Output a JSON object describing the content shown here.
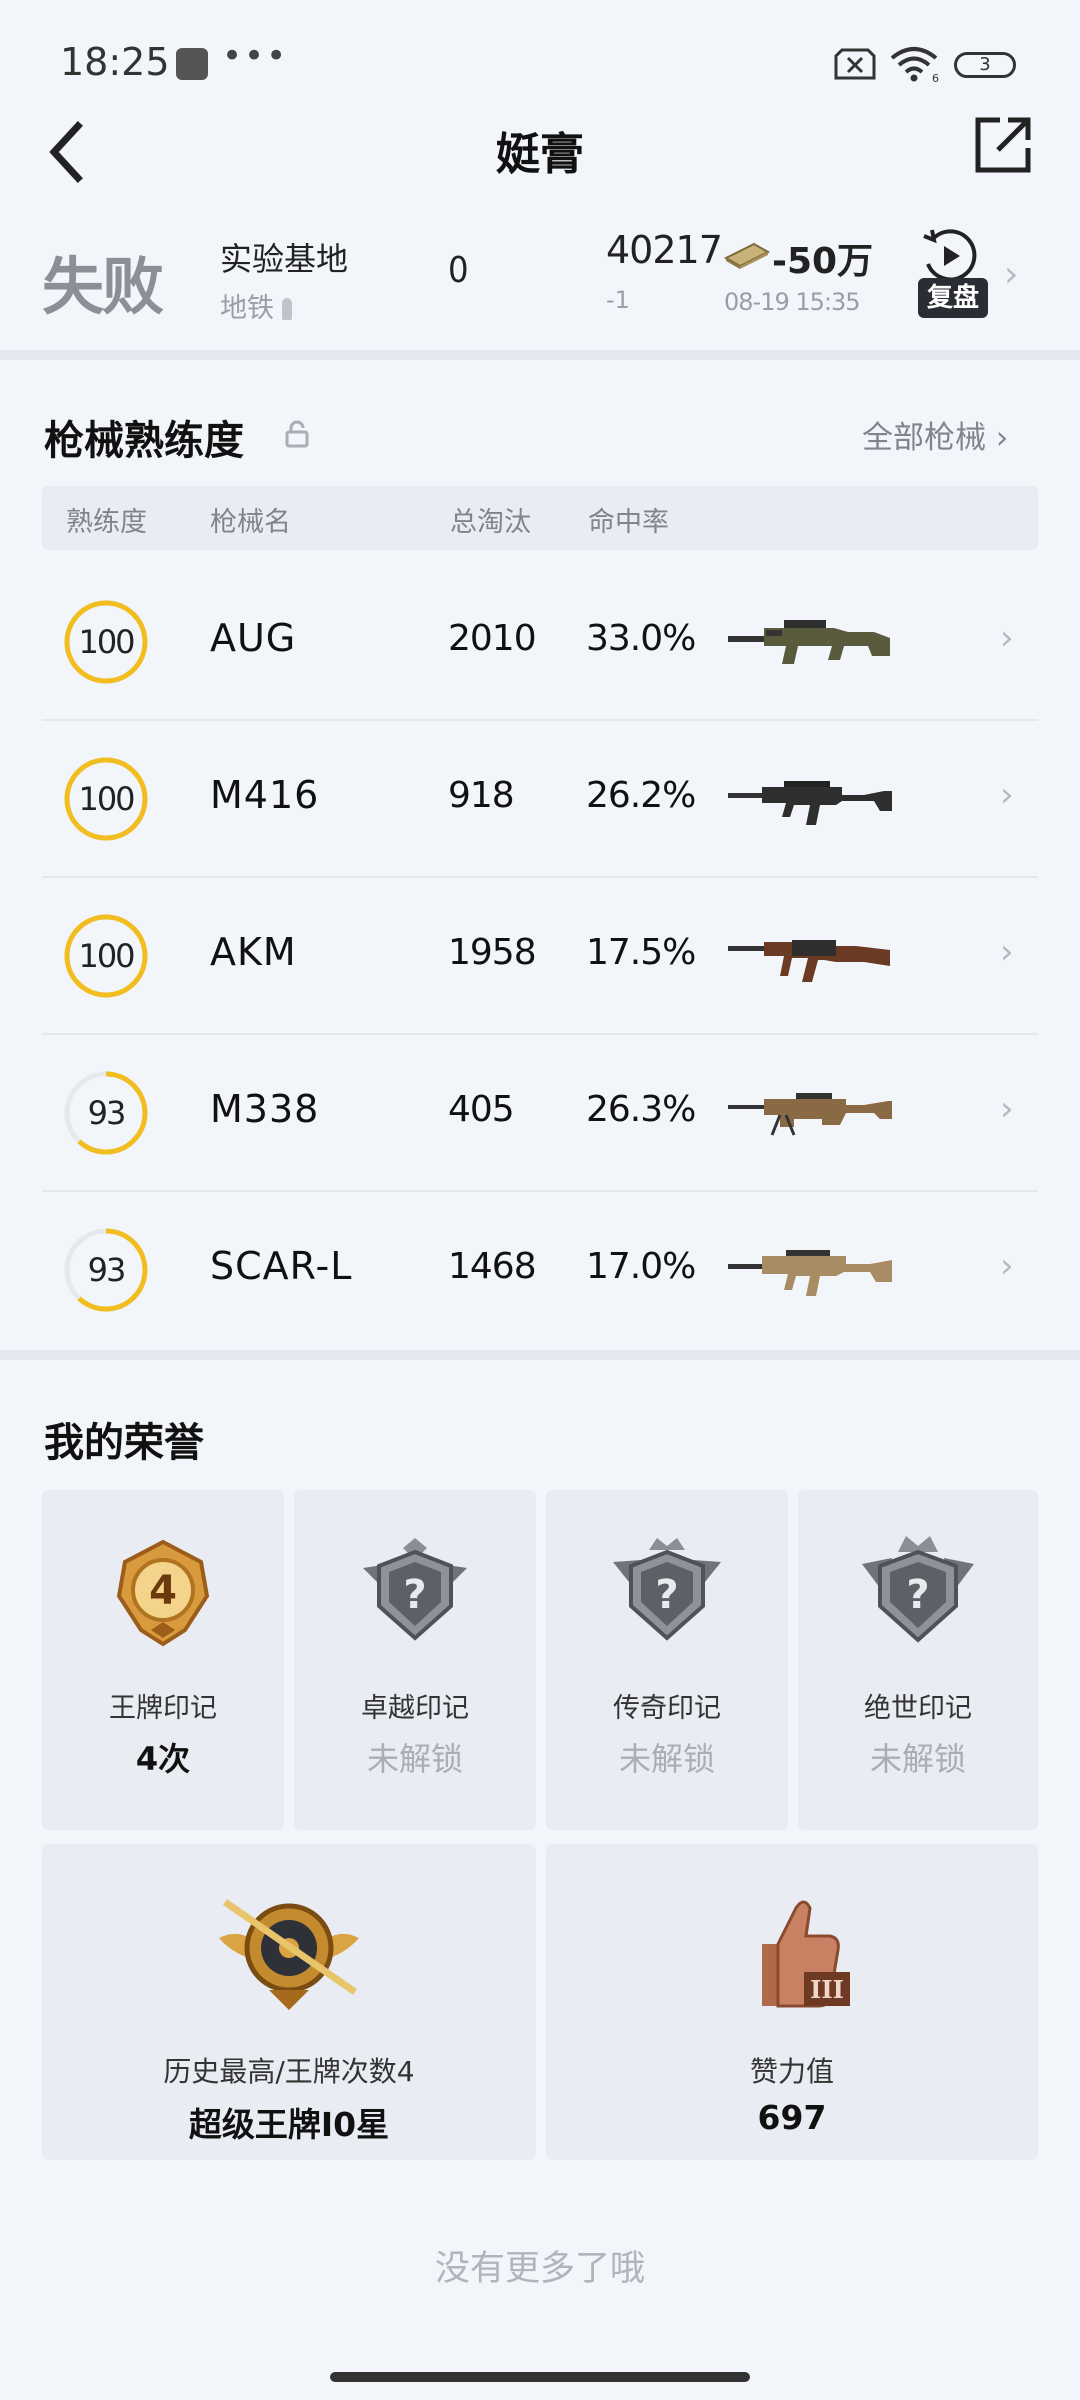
{
  "status_bar": {
    "time": "18:25",
    "dots": "•••",
    "battery": "3",
    "wifi_sub": "6"
  },
  "nav": {
    "title": "娗膏"
  },
  "match": {
    "result": "失败",
    "map": "实验基地",
    "mode": "地铁",
    "kills": "0",
    "points": "40217",
    "points_delta": "-1",
    "money": "-50万",
    "time": "08-19 15:35",
    "replay_label": "复盘",
    "chevron": "›"
  },
  "weapons": {
    "title": "枪械熟练度",
    "all_link": "全部枪械 ›",
    "headers": {
      "mastery": "熟练度",
      "name": "枪械名",
      "kills": "总淘汰",
      "accuracy": "命中率"
    },
    "rows": [
      {
        "mastery": "100",
        "name": "AUG",
        "kills": "2010",
        "accuracy": "33.0%",
        "progress": 1.0,
        "chevron": "›"
      },
      {
        "mastery": "100",
        "name": "M416",
        "kills": "918",
        "accuracy": "26.2%",
        "progress": 1.0,
        "chevron": "›"
      },
      {
        "mastery": "100",
        "name": "AKM",
        "kills": "1958",
        "accuracy": "17.5%",
        "progress": 1.0,
        "chevron": "›"
      },
      {
        "mastery": "93",
        "name": "M338",
        "kills": "405",
        "accuracy": "26.3%",
        "progress": 0.62,
        "chevron": "›"
      },
      {
        "mastery": "93",
        "name": "SCAR-L",
        "kills": "1468",
        "accuracy": "17.0%",
        "progress": 0.62,
        "chevron": "›"
      }
    ]
  },
  "honors": {
    "title": "我的荣誉",
    "cards": [
      {
        "name": "王牌印记",
        "value": "4次",
        "badge_number": "4",
        "locked": false
      },
      {
        "name": "卓越印记",
        "value": "未解锁",
        "badge_number": "?",
        "locked": true
      },
      {
        "name": "传奇印记",
        "value": "未解锁",
        "badge_number": "?",
        "locked": true
      },
      {
        "name": "绝世印记",
        "value": "未解锁",
        "badge_number": "?",
        "locked": true
      }
    ],
    "highest": {
      "label": "历史最高/王牌次数4",
      "value": "超级王牌I0星"
    },
    "likes": {
      "label": "赞力值",
      "value": "697",
      "badge_number": "III"
    }
  },
  "footer": {
    "end_text": "没有更多了哦"
  },
  "colors": {
    "accent_ring": "#f2bd1f",
    "ring_track": "#e6e8ec"
  }
}
